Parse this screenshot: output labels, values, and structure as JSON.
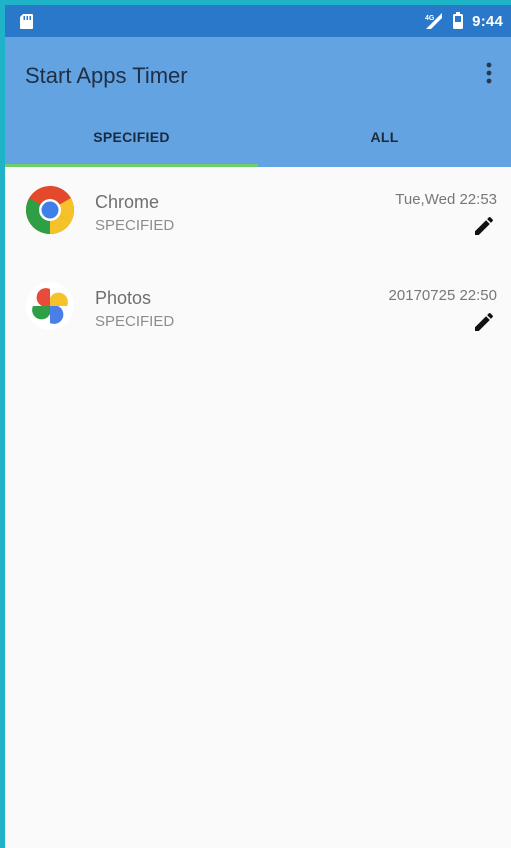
{
  "status_bar": {
    "time": "9:44",
    "icons": {
      "left": "sd-card-icon",
      "signal": "signal-icon",
      "battery": "battery-icon"
    }
  },
  "app_bar": {
    "title": "Start Apps Timer",
    "menu_icon": "overflow-menu-icon"
  },
  "tabs": [
    {
      "label": "SPECIFIED",
      "selected": true
    },
    {
      "label": "ALL",
      "selected": false
    }
  ],
  "items": [
    {
      "name": "Chrome",
      "mode": "SPECIFIED",
      "time": "Tue,Wed 22:53",
      "icon": "chrome-icon",
      "edit_icon": "edit-icon"
    },
    {
      "name": "Photos",
      "mode": "SPECIFIED",
      "time": "20170725 22:50",
      "icon": "photos-icon",
      "edit_icon": "edit-icon"
    }
  ],
  "colors": {
    "status_bar": "#2a78c9",
    "app_bar": "#63a3e2",
    "tab_indicator": "#6ccf6a",
    "background": "#fafafa",
    "frame": "#1fb3c7"
  }
}
